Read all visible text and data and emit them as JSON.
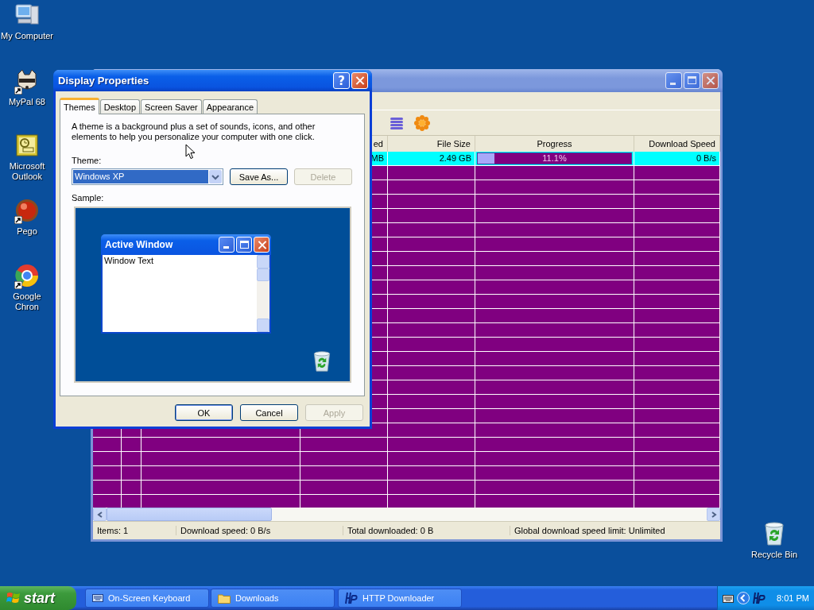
{
  "desktop_icons": [
    {
      "label": "My Computer",
      "kind": "computer",
      "shortcut": false
    },
    {
      "label": "MyPal 68",
      "kind": "raccoon",
      "shortcut": true
    },
    {
      "label": "Microsoft Outlook",
      "kind": "outlook",
      "shortcut": false
    },
    {
      "label": "Pego",
      "kind": "ball",
      "shortcut": true
    },
    {
      "label": "Google Chron",
      "kind": "ring",
      "shortcut": true
    },
    {
      "label": "Recycle Bin",
      "kind": "bin",
      "shortcut": false
    }
  ],
  "downloader": {
    "columns": [
      "ed",
      "File Size",
      "Progress",
      "Download Speed"
    ],
    "rows": [
      {
        "downloaded": "MB",
        "file_size": "2.49 GB",
        "progress": {
          "level": 0.11,
          "text": "11.1%"
        },
        "speed": "0 B/s",
        "selected": true
      }
    ],
    "status_bar": [
      "Items: 1",
      "Download speed: 0 B/s",
      "Total downloaded: 0 B",
      "Global download speed limit: Unlimited"
    ]
  },
  "dialog": {
    "title": "Display Properties",
    "help": "?",
    "tabs": [
      {
        "label": "Themes",
        "selected": true
      },
      {
        "label": "Desktop",
        "selected": false
      },
      {
        "label": "Screen Saver",
        "selected": false
      },
      {
        "label": "Appearance",
        "selected": false
      }
    ],
    "description": "A theme is a background plus a set of sounds, icons, and other elements to help you personalize your computer with one click.",
    "theme_label": "Theme:",
    "theme_value": "Windows XP",
    "side_buttons": [
      {
        "label": "Save As...",
        "disabled": false
      },
      {
        "label": "Delete",
        "disabled": true
      }
    ],
    "sample_label": "Sample:",
    "sample": {
      "window_title": "Active Window",
      "window_text": "Window Text"
    },
    "buttons": [
      {
        "label": "OK",
        "disabled": false,
        "default": true
      },
      {
        "label": "Cancel",
        "disabled": false,
        "default": false
      },
      {
        "label": "Apply",
        "disabled": true,
        "default": false
      }
    ]
  },
  "taskbar": {
    "start": "start",
    "tasks": [
      {
        "label": "On-Screen Keyboard",
        "kind": "keyboard",
        "selected": false
      },
      {
        "label": "Downloads",
        "kind": "folder",
        "selected": false
      },
      {
        "label": "HTTP Downloader",
        "kind": "hp",
        "selected": false
      }
    ],
    "clock": "8:01 PM"
  }
}
